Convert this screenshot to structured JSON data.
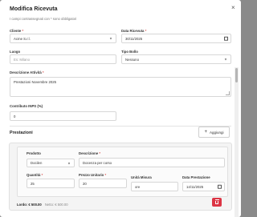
{
  "modal": {
    "title": "Modifica Ricevuta",
    "required_note": "I campi contrassegnati con * sono obbligatori"
  },
  "form": {
    "cliente": {
      "label": "Cliente",
      "required": "*",
      "value": "Acme S.r.l."
    },
    "data_ricevuta": {
      "label": "Data Ricevuta",
      "required": "*",
      "value": "30/11/2025"
    },
    "luogo": {
      "label": "Luogo",
      "placeholder": "Es: Milano"
    },
    "tipo_bollo": {
      "label": "Tipo Bollo",
      "value": "Nessuno"
    },
    "descrizione_attivita": {
      "label": "Descrizione Attività",
      "required": "*",
      "value": "Prestazioni Novembre 2025"
    },
    "contributo_inps": {
      "label": "Contributo INPS (%)",
      "value": "0"
    }
  },
  "prestazioni": {
    "title": "Prestazioni",
    "add_label": "Aggiungi",
    "items": [
      {
        "prodotto_label": "Prodotto",
        "prodotto_value": "Docilen",
        "descrizione_label": "Descrizione",
        "descrizione_required": "*",
        "descrizione_value": "Docenza per corso",
        "quantita_label": "Quantità",
        "quantita_required": "*",
        "quantita_value": "25",
        "prezzo_label": "Prezzo Unitario",
        "prezzo_required": "*",
        "prezzo_value": "20",
        "unita_label": "Unità Misura",
        "unita_value": "ore",
        "data_label": "Data Prestazione",
        "data_value": "14/11/2025",
        "lordo": "Lordo: € 500.00",
        "netto": "Netto: € 500.00"
      }
    ]
  },
  "icons": {
    "close": "close-icon",
    "calendar": "calendar-icon",
    "caret": "chevron-down-icon",
    "plus": "plus-icon",
    "trash": "trash-icon"
  },
  "colors": {
    "danger": "#dc3545",
    "required": "#d9534f"
  }
}
